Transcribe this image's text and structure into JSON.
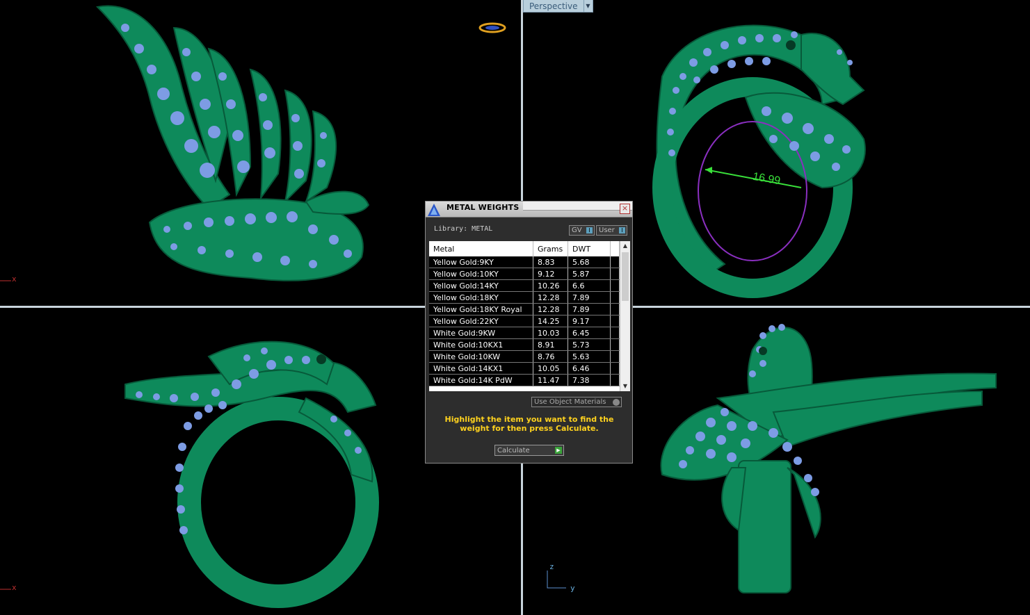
{
  "viewport": {
    "perspective_label": "Perspective",
    "dimension_label": "16.99",
    "axis_tl_x": "x",
    "axis_bl_x": "x",
    "axis_br_z": "z",
    "axis_br_y": "y"
  },
  "dialog": {
    "title": "METAL WEIGHTS",
    "close_glyph": "×",
    "library_label": "Library: METAL",
    "gv_label": "GV",
    "user_label": "User",
    "indicator_glyph": "I",
    "columns": [
      "Metal",
      "Grams",
      "DWT"
    ],
    "rows": [
      [
        "Yellow Gold:9KY",
        "8.83",
        "5.68"
      ],
      [
        "Yellow Gold:10KY",
        "9.12",
        "5.87"
      ],
      [
        "Yellow Gold:14KY",
        "10.26",
        "6.6"
      ],
      [
        "Yellow Gold:18KY",
        "12.28",
        "7.89"
      ],
      [
        "Yellow Gold:18KY Royal",
        "12.28",
        "7.89"
      ],
      [
        "Yellow Gold:22KY",
        "14.25",
        "9.17"
      ],
      [
        "White Gold:9KW",
        "10.03",
        "6.45"
      ],
      [
        "White Gold:10KX1",
        "8.91",
        "5.73"
      ],
      [
        "White Gold:10KW",
        "8.76",
        "5.63"
      ],
      [
        "White Gold:14KX1",
        "10.05",
        "6.46"
      ],
      [
        "White Gold:14K PdW",
        "11.47",
        "7.38"
      ]
    ],
    "use_object_materials_label": "Use Object Materials",
    "message": "Highlight the item you want to find the weight for then press Calculate.",
    "calculate_label": "Calculate"
  },
  "colors": {
    "metal_green": "#0f8a5c",
    "gem_blue": "#7f9de6",
    "message_yellow": "#ffd21e",
    "divider": "#c8d4dc"
  }
}
